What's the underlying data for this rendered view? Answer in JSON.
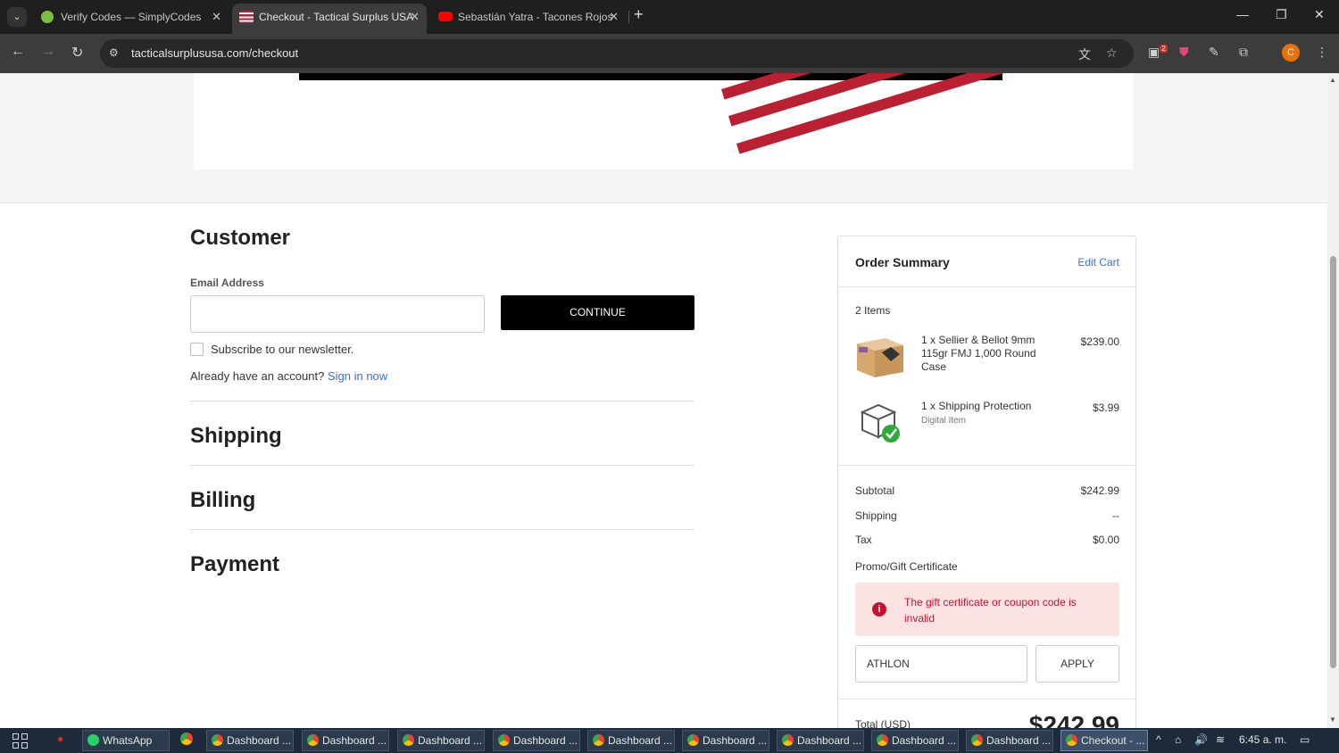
{
  "browser": {
    "tabs": [
      {
        "title": "Verify Codes — SimplyCodes",
        "active": false
      },
      {
        "title": "Checkout - Tactical Surplus USA",
        "active": true
      },
      {
        "title": "Sebastián Yatra - Tacones Rojos",
        "active": false
      }
    ],
    "url": "tacticalsurplususa.com/checkout",
    "profile_initial": "C",
    "extension_badge": "2"
  },
  "checkout": {
    "customer_title": "Customer",
    "email_label": "Email Address",
    "email_value": "",
    "continue_label": "CONTINUE",
    "newsletter_label": "Subscribe to our newsletter.",
    "account_prompt": "Already have an account?",
    "sign_in_link": "Sign in now",
    "shipping_title": "Shipping",
    "billing_title": "Billing",
    "payment_title": "Payment"
  },
  "summary": {
    "title": "Order Summary",
    "edit_cart": "Edit Cart",
    "items_count": "2 Items",
    "items": [
      {
        "name": "1 x Sellier & Bellot 9mm 115gr FMJ 1,000 Round Case",
        "sub": "",
        "price": "$239.00"
      },
      {
        "name": "1 x Shipping Protection",
        "sub": "Digital Item",
        "price": "$3.99"
      }
    ],
    "subtotal_label": "Subtotal",
    "subtotal_value": "$242.99",
    "shipping_label": "Shipping",
    "shipping_value": "--",
    "tax_label": "Tax",
    "tax_value": "$0.00",
    "promo_label": "Promo/Gift Certificate",
    "error_message": "The gift certificate or coupon code is invalid",
    "coupon_value": "ATHLON",
    "apply_label": "APPLY",
    "total_label": "Total (USD)",
    "total_value": "$242.99"
  },
  "taskbar": {
    "items": [
      {
        "label": "WhatsApp",
        "active": false
      },
      {
        "label": "Dashboard ...",
        "active": false
      },
      {
        "label": "Dashboard ...",
        "active": false
      },
      {
        "label": "Dashboard ...",
        "active": false
      },
      {
        "label": "Dashboard ...",
        "active": false
      },
      {
        "label": "Dashboard ...",
        "active": false
      },
      {
        "label": "Dashboard ...",
        "active": false
      },
      {
        "label": "Dashboard ...",
        "active": false
      },
      {
        "label": "Dashboard ...",
        "active": false
      },
      {
        "label": "Dashboard ...",
        "active": false
      },
      {
        "label": "Checkout - ...",
        "active": true
      }
    ],
    "clock": "6:45 a. m."
  },
  "colors": {
    "brand_red": "#ba2032",
    "link_blue": "#3b6fd6",
    "error_red": "#c8102e",
    "error_bg": "#fbe3e4"
  }
}
